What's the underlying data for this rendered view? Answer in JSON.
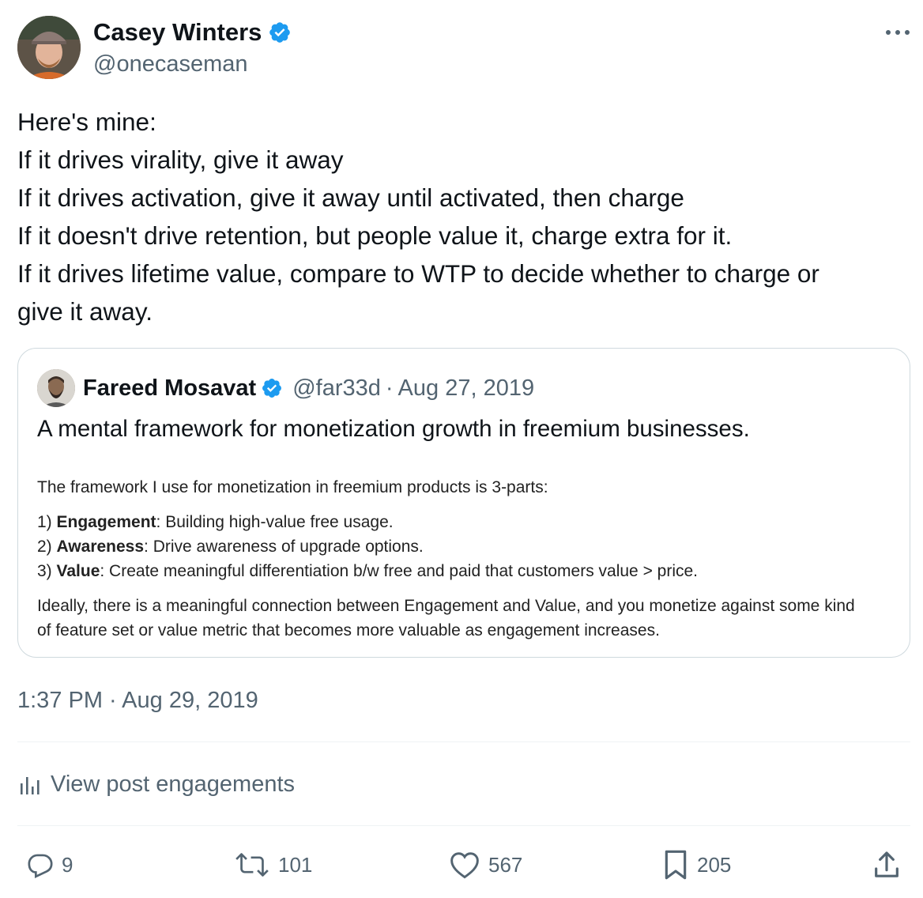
{
  "author": {
    "name": "Casey Winters",
    "handle": "@onecaseman"
  },
  "more_icon": "more-horizontal-icon",
  "tweet": {
    "lines": [
      "Here's mine:",
      "If it drives virality, give it away",
      "If it drives activation, give it away until activated, then charge",
      "If it doesn't drive retention, but people value it, charge extra for it.",
      "If it drives lifetime value, compare to WTP to decide whether to charge or",
      "give it away."
    ]
  },
  "quote": {
    "name": "Fareed Mosavat",
    "handle": "@far33d",
    "separator": "·",
    "date": "Aug 27, 2019",
    "text": "A mental framework for monetization growth in freemium businesses.",
    "image": {
      "intro": "The framework I use for monetization in freemium products is 3-parts:",
      "items": [
        {
          "prefix": "1) ",
          "bold": "Engagement",
          "rest": ": Building high-value free usage."
        },
        {
          "prefix": "2) ",
          "bold": "Awareness",
          "rest": ": Drive awareness of upgrade options."
        },
        {
          "prefix": "3) ",
          "bold": "Value",
          "rest": ": Create meaningful differentiation b/w free and paid that customers value > price."
        }
      ],
      "outro_line1": "Ideally, there is a meaningful connection between Engagement and Value, and you monetize against some kind",
      "outro_line2": "of feature set or value metric that becomes more valuable as engagement increases."
    }
  },
  "timestamp": "1:37 PM · Aug 29, 2019",
  "engagements_label": "View post engagements",
  "actions": {
    "replies": "9",
    "reposts": "101",
    "likes": "567",
    "bookmarks": "205"
  },
  "colors": {
    "verified": "#1d9bf0",
    "secondary_text": "#536471",
    "border": "#cfd9de"
  }
}
